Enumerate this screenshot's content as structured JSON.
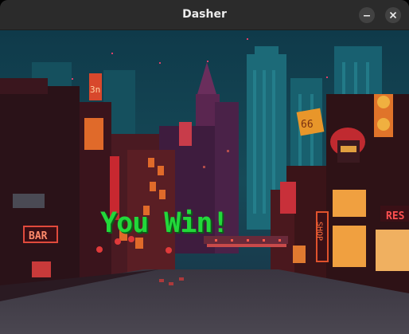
{
  "window": {
    "title": "Dasher"
  },
  "controls": {
    "minimize_icon": "minimize-icon",
    "close_icon": "close-icon"
  },
  "game": {
    "message": "You Win!",
    "message_color": "#22d83a"
  },
  "signs": {
    "left_bar": "BAR",
    "left_top": "3n",
    "right_shop": "SHOP",
    "right_res": "RES",
    "right_66": "66"
  }
}
